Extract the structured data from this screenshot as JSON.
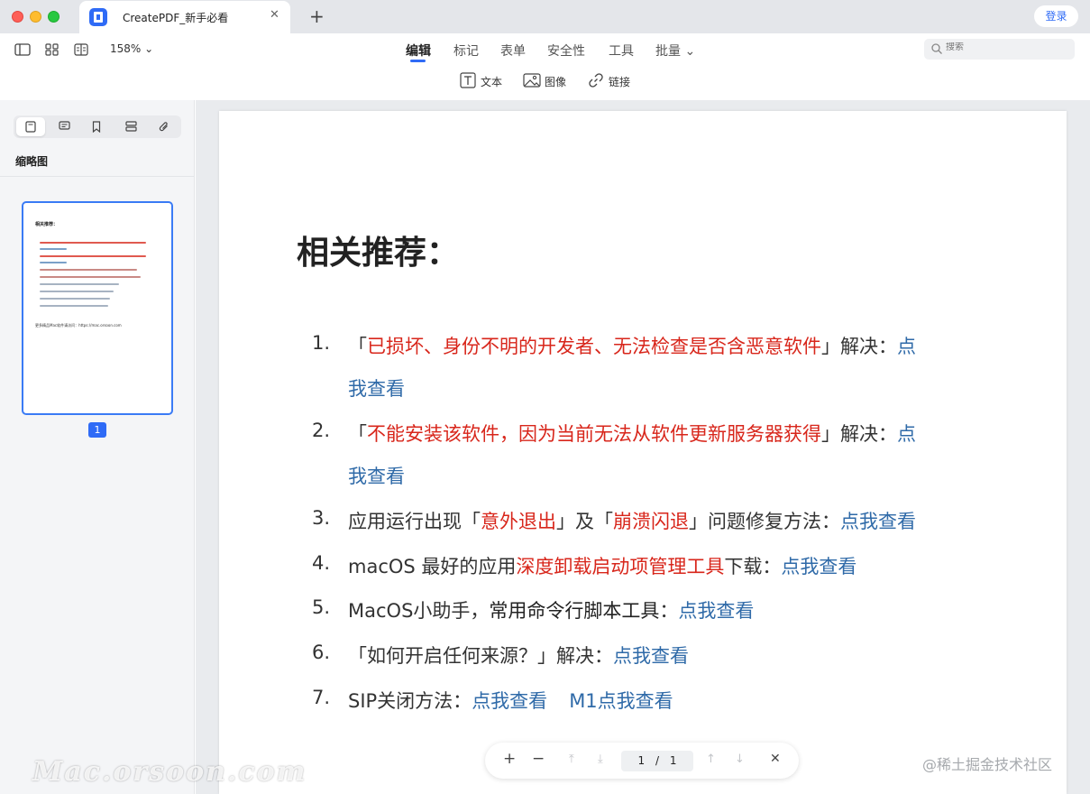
{
  "titlebar": {
    "tab_title": "CreatePDF_新手必看",
    "close_glyph": "✕",
    "new_tab_glyph": "+",
    "login": "登录"
  },
  "toolbar": {
    "zoom": "158% ⌄",
    "tabs": [
      "编辑",
      "标记",
      "表单",
      "安全性",
      "工具",
      "批量 ⌄"
    ],
    "active_tab": "编辑",
    "search_placeholder": "搜索",
    "edit_tools": [
      "文本",
      "图像",
      "链接"
    ]
  },
  "sidebar": {
    "title": "缩略图",
    "thumbnail_title": "相关推荐：",
    "thumbnail_footer": "更多精品Mac软件请访问：https://mac.orsoon.com",
    "page_number": "1"
  },
  "document": {
    "heading": "相关推荐：",
    "items": [
      {
        "num": "1.",
        "open": "「",
        "red": "已损坏、身份不明的开发者、无法检查是否含恶意软件",
        "close": "」解决：",
        "link1": "点",
        "link2": "我查看"
      },
      {
        "num": "2.",
        "open": "「",
        "red": "不能安装该软件，因为当前无法从软件更新服务器获得",
        "close": "」解决：",
        "link1": "点",
        "link2": "我查看"
      },
      {
        "num": "3.",
        "pre": "应用运行出现「",
        "red1": "意外退出",
        "mid": "」及「",
        "red2": "崩溃闪退",
        "post": "」问题修复方法：",
        "link": "点我查看"
      },
      {
        "num": "4.",
        "pre": "macOS 最好的应用",
        "red": "深度卸载启动项管理工具",
        "post": "下载：",
        "link": "点我查看"
      },
      {
        "num": "5.",
        "pre": "MacOS小助手，",
        "black": "常用命令行脚本工具",
        "post": "：",
        "link": "点我查看"
      },
      {
        "num": "6.",
        "pre": "「如何开启任何来源？」解决：",
        "link": "点我查看"
      },
      {
        "num": "7.",
        "pre": "SIP关闭方法：",
        "link": "点我查看",
        "link_b": "M1点我查看"
      }
    ]
  },
  "pagebar": {
    "zoom_in": "+",
    "zoom_out": "−",
    "first": "⤒",
    "last": "⤓",
    "current": "1",
    "separator": "/",
    "total": "1",
    "prev": "↑",
    "next": "↓",
    "close": "✕"
  },
  "watermarks": {
    "left": "Mac.orsoon.com",
    "right": "@稀土掘金技术社区"
  },
  "colors": {
    "accent": "#2f6bf6",
    "emphasis_red": "#d8261b",
    "link_blue": "#2f6aa8"
  }
}
